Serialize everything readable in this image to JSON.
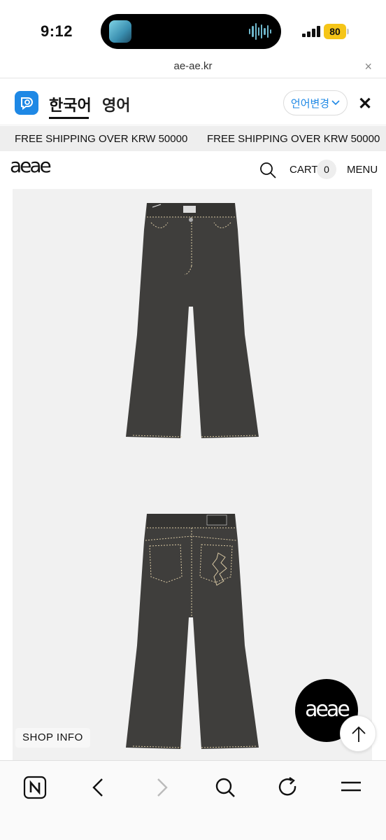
{
  "status_bar": {
    "time": "9:12",
    "battery": "80"
  },
  "browser": {
    "url": "ae-ae.kr",
    "close_symbol": "×"
  },
  "translate": {
    "tab_korean": "한국어",
    "tab_english": "영어",
    "change_language": "언어변경",
    "close_symbol": "✕"
  },
  "banner": {
    "messages": [
      "FREE SHIPPING OVER KRW 50000",
      "FREE SHIPPING OVER KRW 50000"
    ]
  },
  "header": {
    "logo": "aeae",
    "cart_label": "CART",
    "cart_count": "0",
    "menu_label": "MENU"
  },
  "product": {
    "shop_info": "SHOP INFO",
    "floating_logo": "aeae",
    "denim_color": "#3f3e3c",
    "stitch_color": "#d9c9a4"
  },
  "icons": {
    "toolbar": [
      "naver-n-icon",
      "back-arrow-icon",
      "forward-arrow-icon",
      "search-icon",
      "refresh-icon",
      "hamburger-menu-icon"
    ]
  }
}
